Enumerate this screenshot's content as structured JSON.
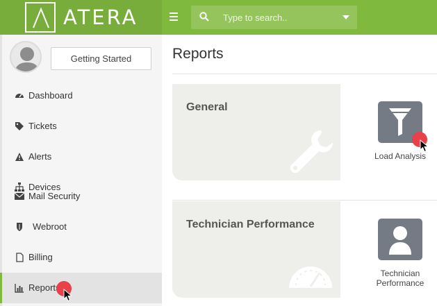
{
  "brand": {
    "name": "ATERA"
  },
  "topbar": {
    "menu_icon": "hamburger-icon",
    "search_icon": "search-icon",
    "search_placeholder": "Type to search.."
  },
  "sidebar": {
    "getting_started_label": "Getting Started",
    "items": [
      {
        "label": "Dashboard",
        "icon": "dashboard-icon"
      },
      {
        "label": "Tickets",
        "icon": "tags-icon"
      },
      {
        "label": "Alerts",
        "icon": "warning-icon"
      },
      {
        "label": "Devices",
        "icon": "sitemap-icon"
      },
      {
        "label": "Mail Security",
        "icon": "envelope-icon"
      },
      {
        "label": "Webroot",
        "icon": "shield-icon"
      },
      {
        "label": "Billing",
        "icon": "file-icon"
      },
      {
        "label": "Reports",
        "icon": "bar-chart-icon",
        "active": true
      }
    ]
  },
  "main": {
    "title": "Reports",
    "sections": [
      {
        "title": "General",
        "icon": "wrench-icon",
        "reports": [
          {
            "label": "Load Analysis",
            "icon": "filter-icon"
          }
        ]
      },
      {
        "title": "Technician Performance",
        "icon": "speedometer-icon",
        "reports": [
          {
            "label_line1": "Technician",
            "label_line2": "Performance",
            "icon": "user-icon"
          }
        ]
      }
    ]
  },
  "colors": {
    "accent": "#7fb93d",
    "tile": "#747b85",
    "click_marker": "#e8414a"
  }
}
